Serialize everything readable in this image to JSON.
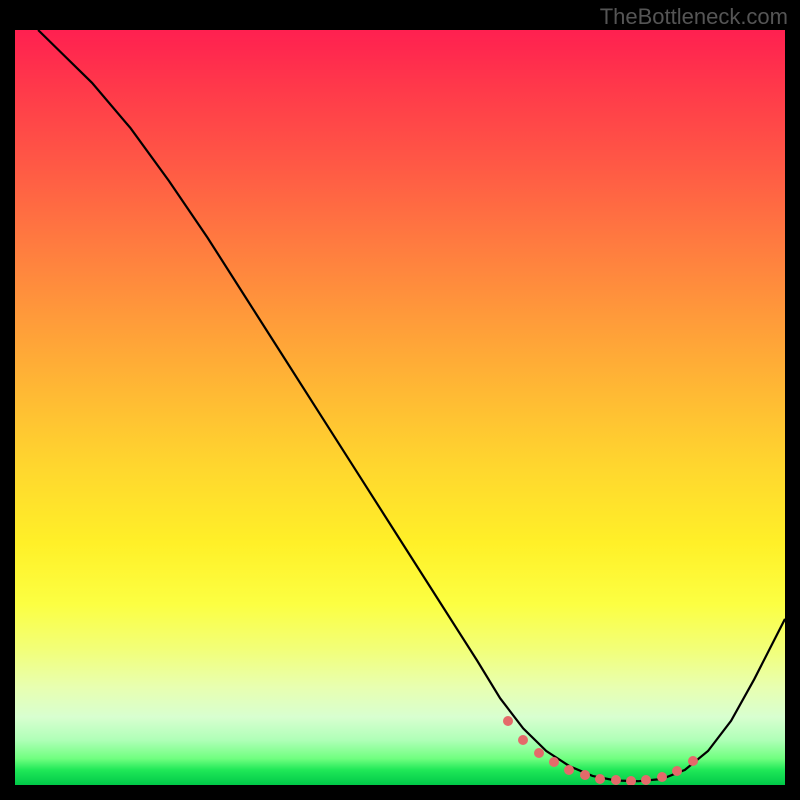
{
  "watermark": "TheBottleneck.com",
  "chart_data": {
    "type": "line",
    "title": "",
    "xlabel": "",
    "ylabel": "",
    "xlim": [
      0,
      100
    ],
    "ylim": [
      0,
      100
    ],
    "series": [
      {
        "name": "curve",
        "x": [
          3,
          6,
          10,
          15,
          20,
          25,
          30,
          35,
          40,
          45,
          50,
          55,
          60,
          63,
          66,
          69,
          72,
          75,
          78,
          81,
          84,
          87,
          90,
          93,
          96,
          100
        ],
        "y": [
          100,
          97,
          93,
          87,
          80,
          72.5,
          64.5,
          56.5,
          48.5,
          40.5,
          32.5,
          24.5,
          16.5,
          11.5,
          7.5,
          4.5,
          2.5,
          1.2,
          0.6,
          0.5,
          0.8,
          2.0,
          4.5,
          8.5,
          14.0,
          22.0
        ]
      }
    ],
    "highlight_dots": {
      "name": "optimal-range",
      "x": [
        64,
        66,
        68,
        70,
        72,
        74,
        76,
        78,
        80,
        82,
        84,
        86,
        88
      ],
      "y": [
        8.5,
        6.0,
        4.2,
        3.0,
        2.0,
        1.3,
        0.8,
        0.6,
        0.5,
        0.6,
        1.0,
        1.8,
        3.2
      ]
    },
    "background": "vertical-gradient red→orange→yellow→green"
  }
}
